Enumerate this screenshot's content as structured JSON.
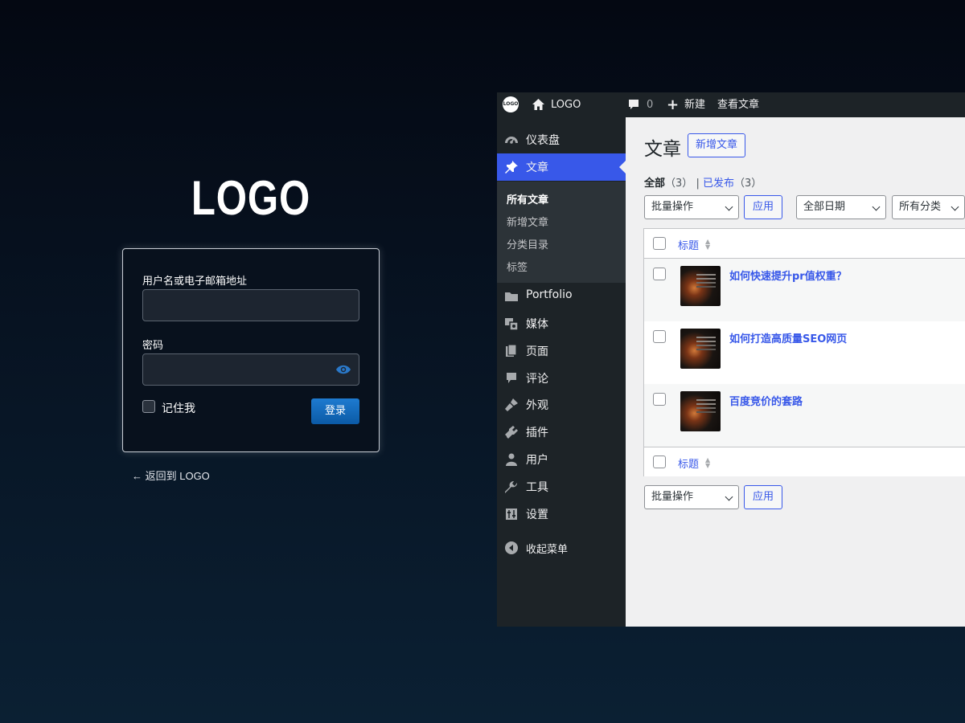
{
  "login": {
    "logo": "LOGO",
    "username_label": "用户名或电子邮箱地址",
    "username_value": "",
    "password_label": "密码",
    "password_value": "",
    "remember_label": "记住我",
    "submit_label": "登录",
    "back_link": "← 返回到 LOGO",
    "accent_color": "#0b5aa6"
  },
  "admin_bar": {
    "wp_logo": "LOGO",
    "site_name": "LOGO",
    "comments_count": "0",
    "new_label": "新建",
    "view_label": "查看文章"
  },
  "sidebar": {
    "items": [
      {
        "label": "仪表盘",
        "icon": "dashboard-icon"
      },
      {
        "label": "文章",
        "icon": "pushpin-icon",
        "active": true
      },
      {
        "label": "Portfolio",
        "icon": "folder-icon"
      },
      {
        "label": "媒体",
        "icon": "media-icon"
      },
      {
        "label": "页面",
        "icon": "pages-icon"
      },
      {
        "label": "评论",
        "icon": "comment-icon"
      },
      {
        "label": "外观",
        "icon": "paintbrush-icon"
      },
      {
        "label": "插件",
        "icon": "plugin-icon"
      },
      {
        "label": "用户",
        "icon": "user-icon"
      },
      {
        "label": "工具",
        "icon": "wrench-icon"
      },
      {
        "label": "设置",
        "icon": "settings-icon"
      }
    ],
    "submenu": [
      "所有文章",
      "新增文章",
      "分类目录",
      "标签"
    ],
    "collapse_label": "收起菜单",
    "accent_color": "#3858e9"
  },
  "posts": {
    "title": "文章",
    "add_new": "新增文章",
    "filters": {
      "all_label": "全部",
      "all_count": "（3）",
      "separator": "|",
      "published_label": "已发布",
      "published_count": "（3）"
    },
    "bulk_action": "批量操作",
    "apply": "应用",
    "date_filter": "全部日期",
    "category_filter": "所有分类",
    "column_title": "标题",
    "rows": [
      {
        "title": "如何快速提升pr值权重？"
      },
      {
        "title": "如何打造高质量SEO网页"
      },
      {
        "title": "百度竞价的套路"
      }
    ]
  }
}
